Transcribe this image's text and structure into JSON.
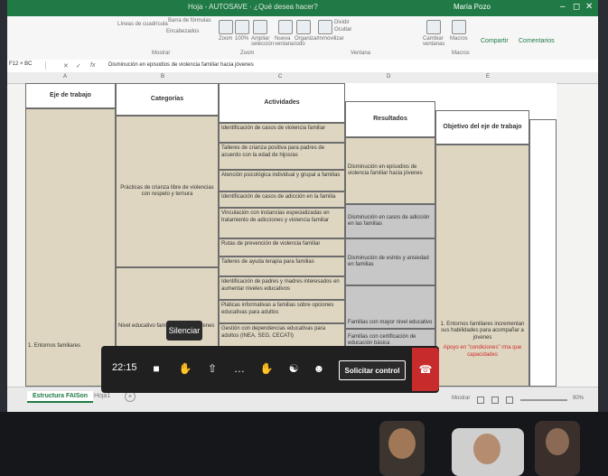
{
  "app": {
    "title": "Hoja - AUTOSAVE · ¿Qué desea hacer?",
    "user_name": "María Pozo",
    "share_label": "Compartir",
    "comments_label": "Comentarios"
  },
  "ribbon": {
    "groups": [
      "Mostrar",
      "Zoom",
      "Ventana",
      "Macros"
    ],
    "items": [
      "Líneas de cuadrícula",
      "Encabezados",
      "Barra de fórmulas",
      "Zoom",
      "100%",
      "Ampliar selección",
      "Nueva ventana",
      "Organizar todo",
      "Inmovilizar",
      "Dividir",
      "Ocultar",
      "Cambiar ventanas",
      "Macros"
    ]
  },
  "formula_bar": {
    "name_box": "F12 × BC",
    "formula": "Disminución en episodios de violencia familiar hacia jóvenes"
  },
  "columns": [
    "A",
    "B",
    "C",
    "D",
    "E"
  ],
  "table": {
    "headers": {
      "eje": "Eje de trabajo",
      "categorias": "Categorías",
      "actividades": "Actividades",
      "resultados": "Resultados",
      "objetivo": "Objetivo del eje de trabajo"
    },
    "eje_value": "1. Entornos familiares",
    "categorias": [
      "Prácticas de crianza libre de violencias con respeto y ternura",
      "Nivel educativo familiar y de los jóvenes"
    ],
    "actividades": [
      "Identificación de casos de violencia familiar",
      "Talleres de crianza positiva para padres de acuerdo con la edad de hijos/as",
      "Atención psicológica individual y grupal a familias",
      "Identificación de casos de adicción en la familia",
      "Vinculación con instancias especializadas en tratamiento de adicciones y violencia familiar",
      "Rutas de prevención de violencia familiar",
      "Talleres de ayuda terapia para familias",
      "Identificación de padres y madres interesados en aumentar niveles educativos",
      "Pláticas informativas a familias sobre opciones educativas para adultos",
      "Gestión con dependencias educativas para adultos (INEA, SEG, CECATI)"
    ],
    "resultados": [
      "Disminución en episodios de violencia familiar hacia jóvenes",
      "Disminución en casos de adicción en las familias",
      "Disminución de estrés y ansiedad en familias",
      "Familias con mayor nivel educativo",
      "Familias con certificación de educación básica"
    ],
    "objetivo": "1. Entornos familiares incrementan sus habilidades para acompañar a jóvenes",
    "objetivo_note": "Apoyo en \"condiciones\" rma que capacidades"
  },
  "sheet_tabs": {
    "active": "Estructura FAISon",
    "other": "Hoja1",
    "add": "+"
  },
  "status_bar": {
    "view_label": "Mostrar",
    "zoom": "90%"
  },
  "meeting": {
    "tooltip": "Silenciar",
    "timer": "22:15",
    "request_control": "Solicitar control"
  },
  "icons": [
    "camera-icon",
    "hand-icon",
    "share-screen-icon",
    "more-icon",
    "raise-hand-icon",
    "chat-icon",
    "people-icon",
    "hangup-icon"
  ],
  "colors": {
    "excel_green": "#1f7a45",
    "cell_tan": "#ded6c0",
    "cell_gray": "#c7c7c7",
    "hangup_red": "#c72b2b"
  }
}
